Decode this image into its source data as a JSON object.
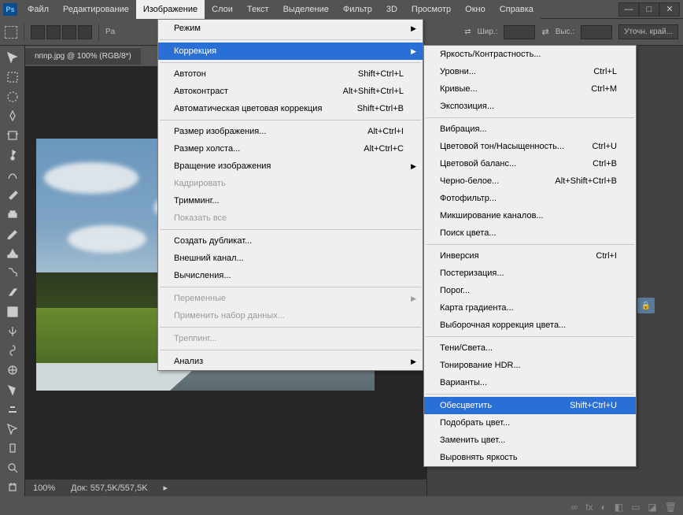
{
  "app": {
    "logo_text": "Ps"
  },
  "menubar": [
    "Файл",
    "Редактирование",
    "Изображение",
    "Слои",
    "Текст",
    "Выделение",
    "Фильтр",
    "3D",
    "Просмотр",
    "Окно",
    "Справка"
  ],
  "menubar_active_index": 2,
  "win_controls": {
    "min": "—",
    "max": "□",
    "close": "✕"
  },
  "toolbar": {
    "width_label": "Шир.:",
    "height_label": "Выс.:",
    "refine": "Уточн. край..."
  },
  "doc_tab": "nпnp.jpg @ 100% (RGB/8*)",
  "status": {
    "zoom": "100%",
    "doc": "Док: 557,5K/557,5K"
  },
  "image_menu": [
    {
      "label": "Режим",
      "arrow": true
    },
    {
      "sep": true
    },
    {
      "label": "Коррекция",
      "arrow": true,
      "hl": true
    },
    {
      "sep": true
    },
    {
      "label": "Автотон",
      "shortcut": "Shift+Ctrl+L"
    },
    {
      "label": "Автоконтраст",
      "shortcut": "Alt+Shift+Ctrl+L"
    },
    {
      "label": "Автоматическая цветовая коррекция",
      "shortcut": "Shift+Ctrl+B"
    },
    {
      "sep": true
    },
    {
      "label": "Размер изображения...",
      "shortcut": "Alt+Ctrl+I"
    },
    {
      "label": "Размер холста...",
      "shortcut": "Alt+Ctrl+C"
    },
    {
      "label": "Вращение изображения",
      "arrow": true
    },
    {
      "label": "Кадрировать",
      "disabled": true
    },
    {
      "label": "Тримминг..."
    },
    {
      "label": "Показать все",
      "disabled": true
    },
    {
      "sep": true
    },
    {
      "label": "Создать дубликат..."
    },
    {
      "label": "Внешний канал..."
    },
    {
      "label": "Вычисления..."
    },
    {
      "sep": true
    },
    {
      "label": "Переменные",
      "arrow": true,
      "disabled": true
    },
    {
      "label": "Применить набор данных...",
      "disabled": true
    },
    {
      "sep": true
    },
    {
      "label": "Треппинг...",
      "disabled": true
    },
    {
      "sep": true
    },
    {
      "label": "Анализ",
      "arrow": true
    }
  ],
  "adjust_menu": [
    {
      "label": "Яркость/Контрастность..."
    },
    {
      "label": "Уровни...",
      "shortcut": "Ctrl+L"
    },
    {
      "label": "Кривые...",
      "shortcut": "Ctrl+M"
    },
    {
      "label": "Экспозиция..."
    },
    {
      "sep": true
    },
    {
      "label": "Вибрация..."
    },
    {
      "label": "Цветовой тон/Насыщенность...",
      "shortcut": "Ctrl+U"
    },
    {
      "label": "Цветовой баланс...",
      "shortcut": "Ctrl+B"
    },
    {
      "label": "Черно-белое...",
      "shortcut": "Alt+Shift+Ctrl+B"
    },
    {
      "label": "Фотофильтр..."
    },
    {
      "label": "Микширование каналов..."
    },
    {
      "label": "Поиск цвета..."
    },
    {
      "sep": true
    },
    {
      "label": "Инверсия",
      "shortcut": "Ctrl+I"
    },
    {
      "label": "Постеризация..."
    },
    {
      "label": "Порог..."
    },
    {
      "label": "Карта градиента..."
    },
    {
      "label": "Выборочная коррекция цвета..."
    },
    {
      "sep": true
    },
    {
      "label": "Тени/Света..."
    },
    {
      "label": "Тонирование HDR..."
    },
    {
      "label": "Варианты..."
    },
    {
      "sep": true
    },
    {
      "label": "Обесцветить",
      "shortcut": "Shift+Ctrl+U",
      "hl": true
    },
    {
      "label": "Подобрать цвет..."
    },
    {
      "label": "Заменить цвет..."
    },
    {
      "label": "Выровнять яркость"
    }
  ],
  "footer_icons": [
    "∞",
    "fx",
    "◐",
    "◧",
    "▭",
    "◪",
    "🗑"
  ]
}
